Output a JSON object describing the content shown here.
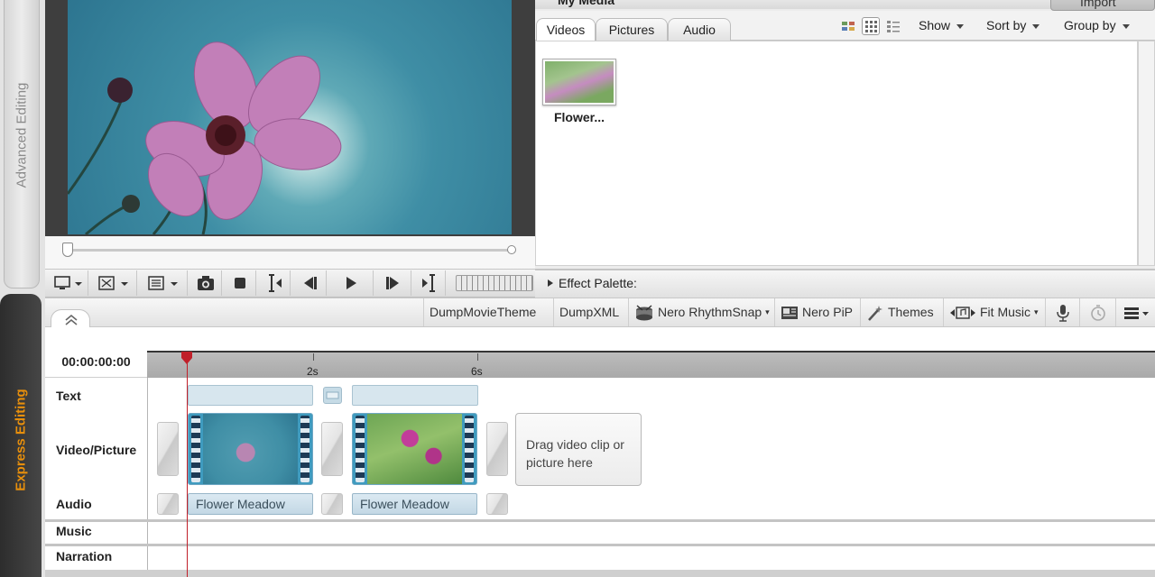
{
  "sidebar": {
    "advanced_label": "Advanced Editing",
    "express_label": "Express Editing"
  },
  "preview": {
    "controls": [
      "display-mode",
      "fullscreen",
      "chapter",
      "snapshot",
      "stop",
      "go-to-start",
      "previous-frame",
      "play",
      "next-frame",
      "go-to-end"
    ]
  },
  "media": {
    "title": "My Media",
    "import_label": "Import",
    "tabs": [
      {
        "label": "Videos",
        "active": true
      },
      {
        "label": "Pictures",
        "active": false
      },
      {
        "label": "Audio",
        "active": false
      }
    ],
    "show_label": "Show",
    "sortby_label": "Sort by",
    "groupby_label": "Group by",
    "items": [
      {
        "label": "Flower..."
      }
    ]
  },
  "effect_palette_label": "Effect Palette:",
  "toolbar": {
    "dump_theme": "DumpMovieTheme",
    "dump_xml": "DumpXML",
    "rhythmsnap": "Nero RhythmSnap",
    "pip": "Nero PiP",
    "themes": "Themes",
    "fitmusic": "Fit Music"
  },
  "timeline": {
    "timecode": "00:00:00:00",
    "ticks": [
      "2s",
      "6s"
    ],
    "tracks": [
      "Text",
      "Video/Picture",
      "Audio",
      "Music",
      "Narration"
    ],
    "drop_hint": "Drag video clip or picture here",
    "audio_clips": [
      "Flower Meadow",
      "Flower Meadow"
    ]
  },
  "colors": {
    "express_accent": "#e78f0c",
    "playhead": "#c0202a",
    "clip_accent": "#3f9bbf"
  }
}
